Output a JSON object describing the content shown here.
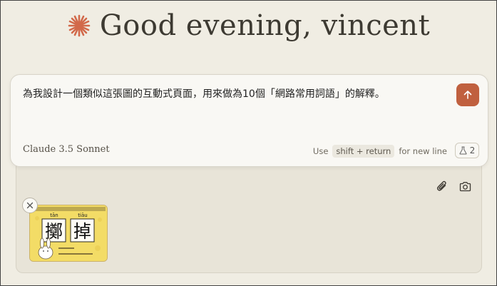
{
  "greeting": {
    "text": "Good evening, vincent"
  },
  "composer": {
    "prompt": "為我設計一個類似這張圖的互動式頁面，用來做為10個「網路常用詞語」的解釋。",
    "model": "Claude 3.5 Sonnet",
    "hint_prefix": "Use",
    "hint_key": "shift + return",
    "hint_suffix": "for new line",
    "project_count": "2"
  },
  "attachment": {
    "pinyin_left": "tān",
    "pinyin_right": "tiāu",
    "char_left": "擲",
    "char_right": "掉"
  },
  "icons": [
    "sparkle-icon",
    "arrow-up-icon",
    "flask-icon",
    "paperclip-icon",
    "camera-icon",
    "close-icon"
  ],
  "colors": {
    "accent": "#c0603f",
    "background": "#f0ede3",
    "tray": "#e8e4d8"
  }
}
